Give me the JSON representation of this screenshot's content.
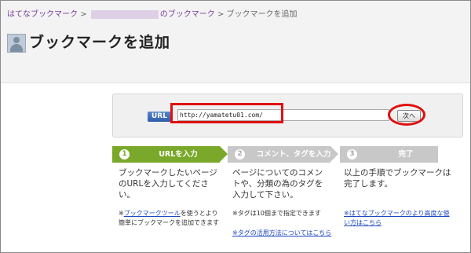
{
  "breadcrumb": {
    "root": "はてなブックマーク",
    "sep1": ">",
    "user_suffix": "のブックマーク",
    "sep2": ">",
    "current": "ブックマークを追加"
  },
  "page": {
    "title": "ブックマークを追加"
  },
  "form": {
    "url_label": "URL",
    "url_value": "http://yamatetu01.com/",
    "next_label": "次へ"
  },
  "steps": [
    {
      "num": "1",
      "label": "URLを入力",
      "desc": "ブックマークしたいページのURLを入力してください。"
    },
    {
      "num": "2",
      "label": "コメント、タグを入力",
      "desc": "ページについてのコメントや、分類の為のタグを入力して下さい。"
    },
    {
      "num": "3",
      "label": "完了",
      "desc": "以上の手順でブックマークは完了します。"
    }
  ],
  "notes": {
    "n1_prefix": "※",
    "n1_link": "ブックマークツール",
    "n1_text": "を使うとより簡単にブックマークを追加できます",
    "n2_text": "※タグは10個まで指定できます",
    "n2_link": "※タグの活用方法についてはこちら",
    "n3_link": "※はてなブックマークのより高度な使い方はこちら"
  },
  "colors": {
    "step_active": "#7aa82a",
    "step_inactive": "#c8c8c8",
    "highlight": "#e01010",
    "link": "#2048c0"
  }
}
